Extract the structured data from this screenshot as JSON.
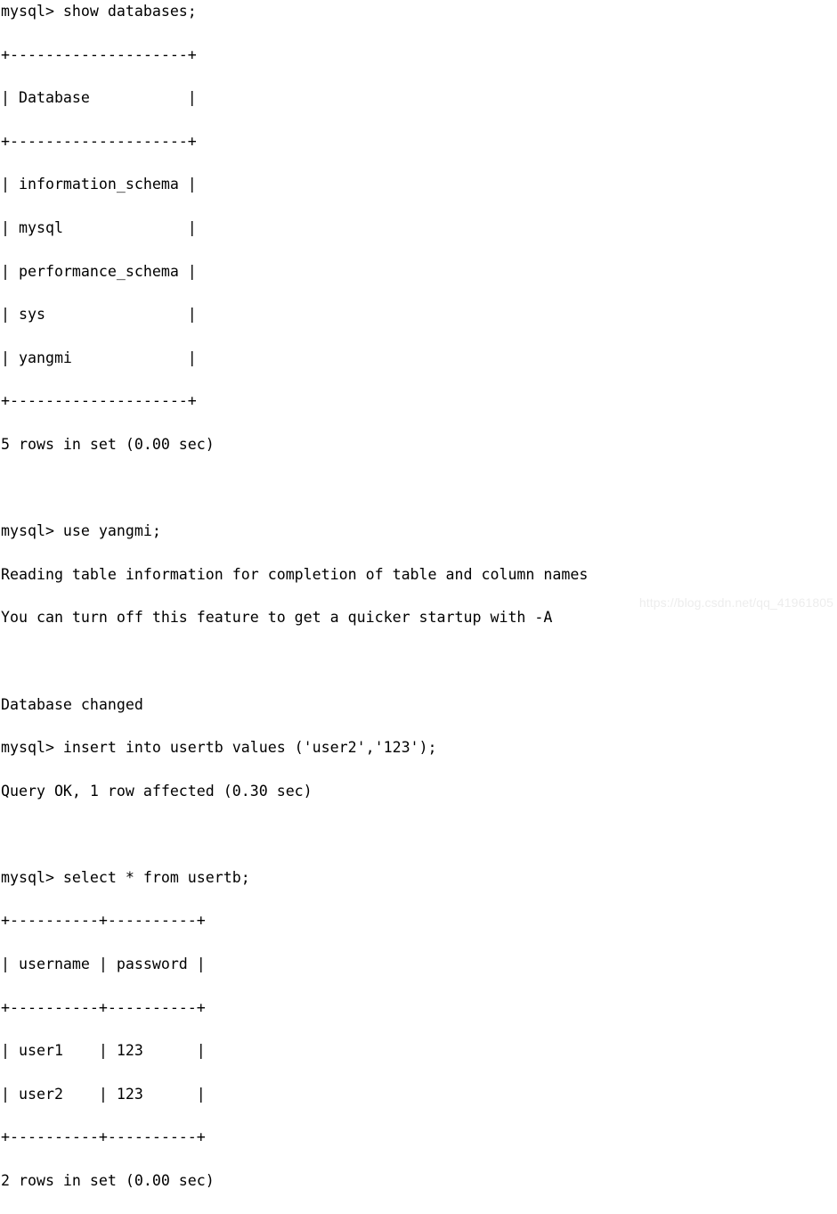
{
  "terminal": {
    "prompt": "mysql>",
    "lines": [
      {
        "id": "cmd-show-databases",
        "type": "command",
        "text": "mysql> show databases;"
      },
      {
        "id": "db-table-top-border",
        "type": "table-border",
        "text": "+--------------------+"
      },
      {
        "id": "db-table-header",
        "type": "table-header",
        "text": "| Database           |"
      },
      {
        "id": "db-table-header-sep",
        "type": "table-border",
        "text": "+--------------------+"
      },
      {
        "id": "db-row-information-schema",
        "type": "table-row",
        "text": "| information_schema |"
      },
      {
        "id": "db-row-mysql",
        "type": "table-row",
        "text": "| mysql              |"
      },
      {
        "id": "db-row-performance-schema",
        "type": "table-row",
        "text": "| performance_schema |"
      },
      {
        "id": "db-row-sys",
        "type": "table-row",
        "text": "| sys                |"
      },
      {
        "id": "db-row-yangmi",
        "type": "table-row",
        "text": "| yangmi             |"
      },
      {
        "id": "db-table-bottom-border",
        "type": "table-border",
        "text": "+--------------------+"
      },
      {
        "id": "db-result-status",
        "type": "status",
        "text": "5 rows in set (0.00 sec)"
      },
      {
        "id": "blank-1",
        "type": "blank",
        "text": ""
      },
      {
        "id": "cmd-use-yangmi",
        "type": "command",
        "text": "mysql> use yangmi;"
      },
      {
        "id": "msg-reading-table-info",
        "type": "message",
        "text": "Reading table information for completion of table and column names"
      },
      {
        "id": "msg-turn-off-feature",
        "type": "message",
        "text": "You can turn off this feature to get a quicker startup with -A"
      },
      {
        "id": "blank-2",
        "type": "blank",
        "text": ""
      },
      {
        "id": "msg-database-changed",
        "type": "message",
        "text": "Database changed"
      },
      {
        "id": "cmd-insert-into-usertb",
        "type": "command",
        "text": "mysql> insert into usertb values ('user2','123');"
      },
      {
        "id": "insert-result-status",
        "type": "status",
        "text": "Query OK, 1 row affected (0.30 sec)"
      },
      {
        "id": "blank-3",
        "type": "blank",
        "text": ""
      },
      {
        "id": "cmd-select-from-usertb",
        "type": "command",
        "text": "mysql> select * from usertb;"
      },
      {
        "id": "user-table-top-border",
        "type": "table-border",
        "text": "+----------+----------+"
      },
      {
        "id": "user-table-header",
        "type": "table-header",
        "text": "| username | password |"
      },
      {
        "id": "user-table-header-sep",
        "type": "table-border",
        "text": "+----------+----------+"
      },
      {
        "id": "user-row-user1",
        "type": "table-row",
        "text": "| user1    | 123      |"
      },
      {
        "id": "user-row-user2",
        "type": "table-row",
        "text": "| user2    | 123      |"
      },
      {
        "id": "user-table-bottom-border",
        "type": "table-border",
        "text": "+----------+----------+"
      },
      {
        "id": "user-result-status",
        "type": "status",
        "text": "2 rows in set (0.00 sec)"
      }
    ],
    "databases_result": {
      "columns": [
        "Database"
      ],
      "rows": [
        [
          "information_schema"
        ],
        [
          "mysql"
        ],
        [
          "performance_schema"
        ],
        [
          "sys"
        ],
        [
          "yangmi"
        ]
      ],
      "row_count": 5,
      "elapsed": "0.00 sec",
      "status_text": "5 rows in set (0.00 sec)"
    },
    "usertb_result": {
      "columns": [
        "username",
        "password"
      ],
      "rows": [
        [
          "user1",
          "123"
        ],
        [
          "user2",
          "123"
        ]
      ],
      "row_count": 2,
      "elapsed": "0.00 sec",
      "status_text": "2 rows in set (0.00 sec)"
    },
    "insert_result": {
      "status": "Query OK",
      "rows_affected": 1,
      "elapsed": "0.30 sec",
      "status_text": "Query OK, 1 row affected (0.30 sec)"
    },
    "active_database": "yangmi",
    "colors": {
      "background": "#ffffff",
      "text": "#000000",
      "watermark": "#ededed"
    }
  },
  "watermark": {
    "text": "https://blog.csdn.net/qq_41961805"
  }
}
